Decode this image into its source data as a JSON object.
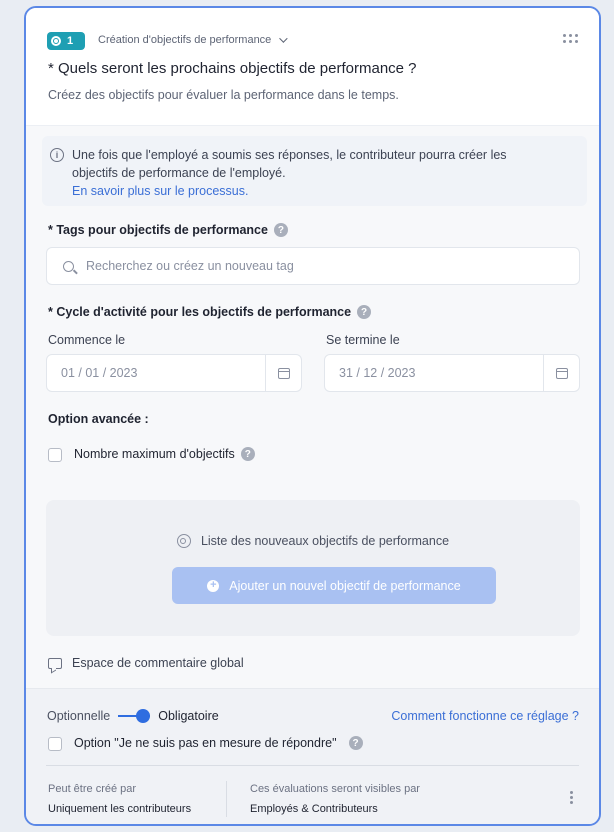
{
  "header": {
    "badge_number": "1",
    "breadcrumb": "Création d'objectifs de performance",
    "question_title": "* Quels seront les prochains objectifs de performance ?",
    "question_subtitle": "Créez des objectifs pour évaluer la performance dans le temps."
  },
  "info": {
    "text_line1": "Une fois que l'employé a soumis ses réponses, le contributeur pourra créer les",
    "text_line2": "objectifs de performance de l'employé.",
    "link": "En savoir plus sur le processus."
  },
  "tags": {
    "label": "* Tags pour objectifs de performance",
    "placeholder": "Recherchez ou créez un nouveau tag"
  },
  "cycle": {
    "label": "* Cycle d'activité pour les objectifs de performance",
    "start_label": "Commence le",
    "start_value": "01 / 01 / 2023",
    "end_label": "Se termine le",
    "end_value": "31 / 12 / 2023"
  },
  "advanced": {
    "label": "Option avancée :",
    "max_objectives_label": "Nombre maximum d'objectifs",
    "max_objectives_checked": false
  },
  "objectives_list": {
    "title": "Liste des nouveaux objectifs de performance",
    "add_button": "Ajouter un nouvel objectif de performance"
  },
  "comment": {
    "label": "Espace de commentaire global"
  },
  "footer": {
    "toggle_off_label": "Optionnelle",
    "toggle_on_label": "Obligatoire",
    "toggle_state": "Obligatoire",
    "how_link": "Comment fonctionne ce réglage ?",
    "unable_option_label": "Option \"Je ne suis pas en mesure de répondre\"",
    "unable_option_checked": false,
    "created_by_label": "Peut être créé par",
    "created_by_value": "Uniquement les contributeurs",
    "visible_by_label": "Ces évaluations seront visibles par",
    "visible_by_value": "Employés & Contributeurs"
  },
  "colors": {
    "accent": "#2f6de0",
    "badge": "#1e9fb3",
    "button_disabled": "#a9c1f2",
    "card_border": "#5b88e6"
  }
}
